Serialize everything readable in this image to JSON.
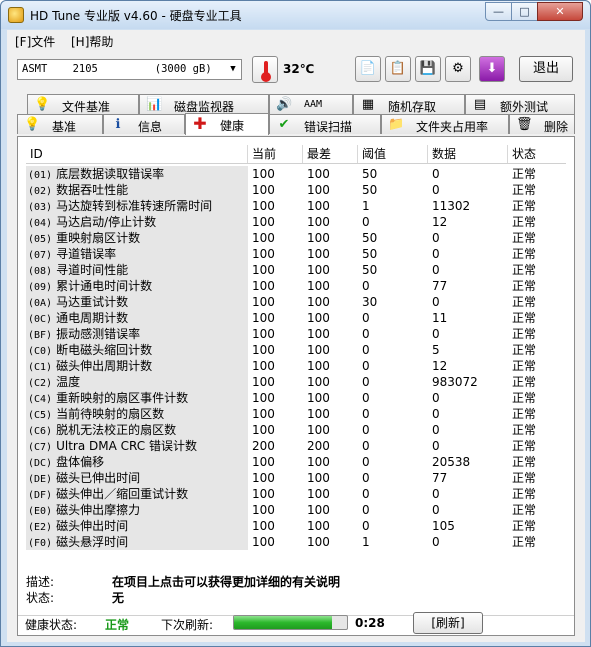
{
  "window": {
    "title": "HD Tune 专业版 v4.60 - 硬盘专业工具",
    "min_label": "—",
    "max_label": "□",
    "close_label": "✕"
  },
  "menu": {
    "file": "[F]文件",
    "help": "[H]帮助"
  },
  "toolbar": {
    "drive": "ASMT    2105         (3000 gB)",
    "temperature": "32℃",
    "exit_label": "退出"
  },
  "tabs_top": [
    "文件基准",
    "磁盘监视器",
    "AAM",
    "随机存取",
    "额外测试"
  ],
  "tabs_bottom": [
    "基准",
    "信息",
    "健康",
    "错误扫描",
    "文件夹占用率",
    "删除"
  ],
  "active_tab": "健康",
  "columns": [
    "ID",
    "当前",
    "最差",
    "阈值",
    "数据",
    "状态"
  ],
  "rows": [
    {
      "code": "(01)",
      "name": "底层数据读取错误率",
      "cur": "100",
      "worst": "100",
      "thr": "50",
      "data": "0",
      "status": "正常"
    },
    {
      "code": "(02)",
      "name": "数据吞吐性能",
      "cur": "100",
      "worst": "100",
      "thr": "50",
      "data": "0",
      "status": "正常"
    },
    {
      "code": "(03)",
      "name": "马达旋转到标准转速所需时间",
      "cur": "100",
      "worst": "100",
      "thr": "1",
      "data": "11302",
      "status": "正常"
    },
    {
      "code": "(04)",
      "name": "马达启动/停止计数",
      "cur": "100",
      "worst": "100",
      "thr": "0",
      "data": "12",
      "status": "正常"
    },
    {
      "code": "(05)",
      "name": "重映射扇区计数",
      "cur": "100",
      "worst": "100",
      "thr": "50",
      "data": "0",
      "status": "正常"
    },
    {
      "code": "(07)",
      "name": "寻道错误率",
      "cur": "100",
      "worst": "100",
      "thr": "50",
      "data": "0",
      "status": "正常"
    },
    {
      "code": "(08)",
      "name": "寻道时间性能",
      "cur": "100",
      "worst": "100",
      "thr": "50",
      "data": "0",
      "status": "正常"
    },
    {
      "code": "(09)",
      "name": "累计通电时间计数",
      "cur": "100",
      "worst": "100",
      "thr": "0",
      "data": "77",
      "status": "正常"
    },
    {
      "code": "(0A)",
      "name": "马达重试计数",
      "cur": "100",
      "worst": "100",
      "thr": "30",
      "data": "0",
      "status": "正常"
    },
    {
      "code": "(0C)",
      "name": "通电周期计数",
      "cur": "100",
      "worst": "100",
      "thr": "0",
      "data": "11",
      "status": "正常"
    },
    {
      "code": "(BF)",
      "name": "振动感测错误率",
      "cur": "100",
      "worst": "100",
      "thr": "0",
      "data": "0",
      "status": "正常"
    },
    {
      "code": "(C0)",
      "name": "断电磁头缩回计数",
      "cur": "100",
      "worst": "100",
      "thr": "0",
      "data": "5",
      "status": "正常"
    },
    {
      "code": "(C1)",
      "name": "磁头伸出周期计数",
      "cur": "100",
      "worst": "100",
      "thr": "0",
      "data": "12",
      "status": "正常"
    },
    {
      "code": "(C2)",
      "name": "温度",
      "cur": "100",
      "worst": "100",
      "thr": "0",
      "data": "983072",
      "status": "正常"
    },
    {
      "code": "(C4)",
      "name": "重新映射的扇区事件计数",
      "cur": "100",
      "worst": "100",
      "thr": "0",
      "data": "0",
      "status": "正常"
    },
    {
      "code": "(C5)",
      "name": "当前待映射的扇区数",
      "cur": "100",
      "worst": "100",
      "thr": "0",
      "data": "0",
      "status": "正常"
    },
    {
      "code": "(C6)",
      "name": "脱机无法校正的扇区数",
      "cur": "100",
      "worst": "100",
      "thr": "0",
      "data": "0",
      "status": "正常"
    },
    {
      "code": "(C7)",
      "name": "Ultra DMA CRC 错误计数",
      "cur": "200",
      "worst": "200",
      "thr": "0",
      "data": "0",
      "status": "正常"
    },
    {
      "code": "(DC)",
      "name": "盘体偏移",
      "cur": "100",
      "worst": "100",
      "thr": "0",
      "data": "20538",
      "status": "正常"
    },
    {
      "code": "(DE)",
      "name": "磁头已伸出时间",
      "cur": "100",
      "worst": "100",
      "thr": "0",
      "data": "77",
      "status": "正常"
    },
    {
      "code": "(DF)",
      "name": "磁头伸出／缩回重试计数",
      "cur": "100",
      "worst": "100",
      "thr": "0",
      "data": "0",
      "status": "正常"
    },
    {
      "code": "(E0)",
      "name": "磁头伸出摩擦力",
      "cur": "100",
      "worst": "100",
      "thr": "0",
      "data": "0",
      "status": "正常"
    },
    {
      "code": "(E2)",
      "name": "磁头伸出时间",
      "cur": "100",
      "worst": "100",
      "thr": "0",
      "data": "105",
      "status": "正常"
    },
    {
      "code": "(F0)",
      "name": "磁头悬浮时间",
      "cur": "100",
      "worst": "100",
      "thr": "1",
      "data": "0",
      "status": "正常"
    }
  ],
  "description": {
    "desc_label": "描述:",
    "desc_value": "在项目上点击可以获得更加详细的有关说明",
    "state_label": "状态:",
    "state_value": "无"
  },
  "statusbar": {
    "health_label": "健康状态:",
    "health_value": "正常",
    "next_refresh_label": "下次刷新:",
    "refresh_progress": 0.87,
    "countdown": "0:28",
    "refresh_button": "[刷新]"
  }
}
